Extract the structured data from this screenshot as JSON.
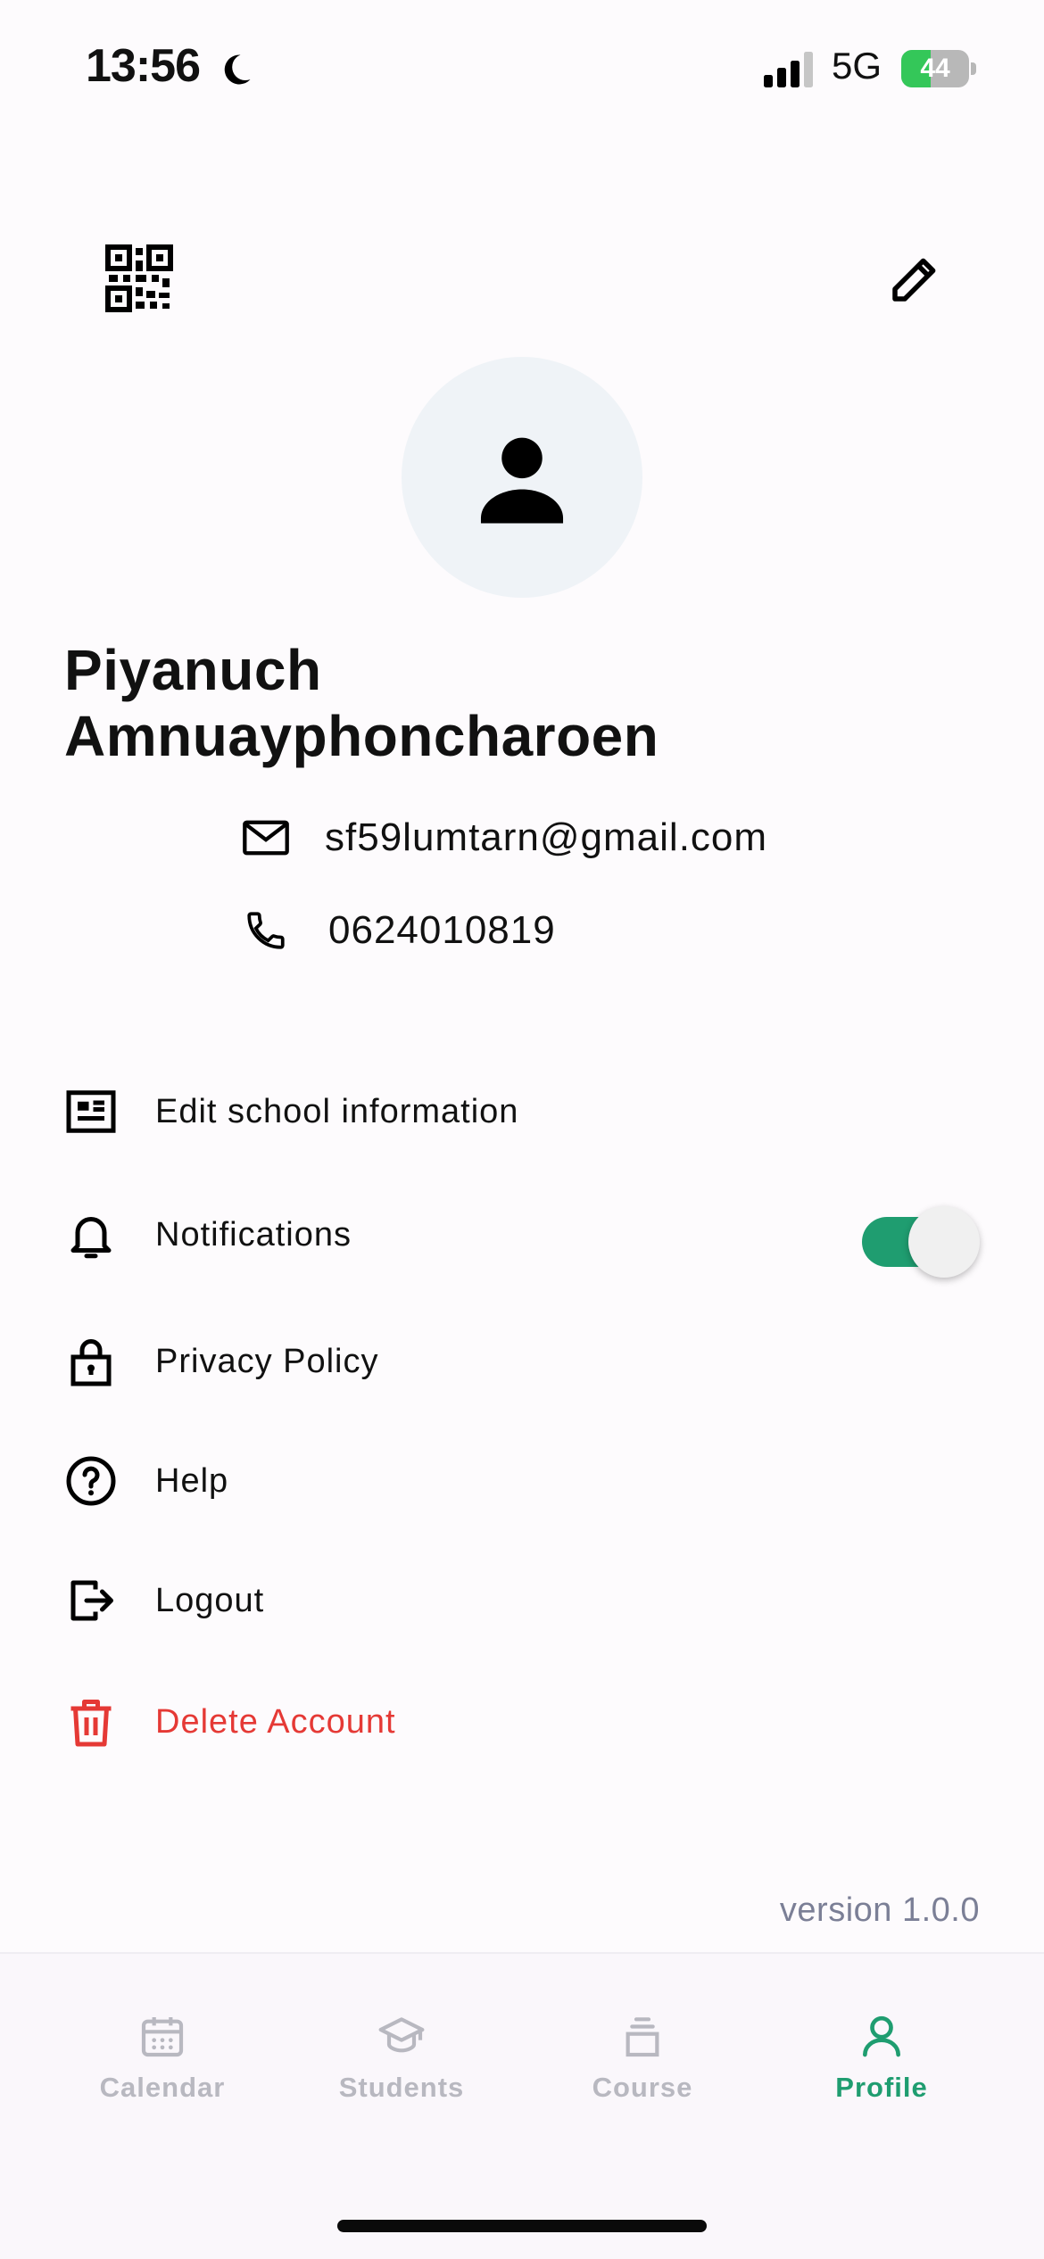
{
  "status_bar": {
    "time": "13:56",
    "network": "5G",
    "battery_level": "44",
    "battery_fraction": 0.44,
    "icons": [
      "moon-icon",
      "signal-icon",
      "battery-icon"
    ]
  },
  "header": {
    "qr_icon": "qr-code-icon",
    "edit_icon": "pencil-icon"
  },
  "profile": {
    "name_first": "Piyanuch",
    "name_last": "Amnuayphoncharoen",
    "email": "sf59lumtarn@gmail.com",
    "phone": "0624010819"
  },
  "menu": {
    "edit_school": "Edit school information",
    "notifications": "Notifications",
    "notifications_enabled": true,
    "privacy_policy": "Privacy Policy",
    "help": "Help",
    "logout": "Logout",
    "delete_account": "Delete Account"
  },
  "version": "version 1.0.0",
  "tabs": [
    {
      "label": "Calendar",
      "icon": "calendar-icon",
      "active": false
    },
    {
      "label": "Students",
      "icon": "graduation-cap-icon",
      "active": false
    },
    {
      "label": "Course",
      "icon": "stack-icon",
      "active": false
    },
    {
      "label": "Profile",
      "icon": "person-icon",
      "active": true
    }
  ],
  "colors": {
    "accent": "#1f9d70",
    "danger": "#e53935",
    "inactive_tab": "#b8b8c0",
    "avatar_bg": "#eff3f7"
  }
}
